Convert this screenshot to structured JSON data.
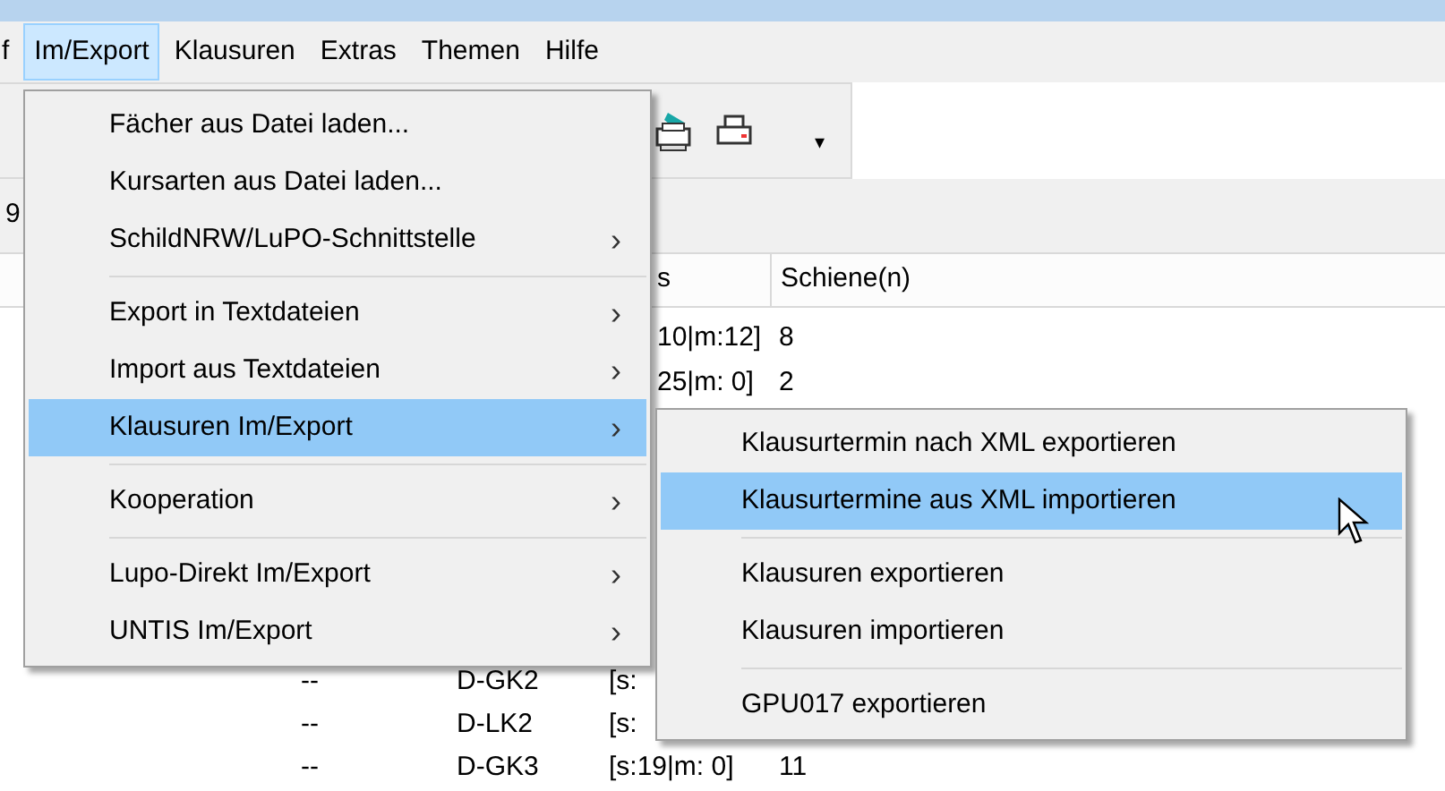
{
  "menu_bar": [
    {
      "label": "f",
      "selected": false
    },
    {
      "label": "Im/Export",
      "selected": true
    },
    {
      "label": "Klausuren",
      "selected": false
    },
    {
      "label": "Extras",
      "selected": false
    },
    {
      "label": "Themen",
      "selected": false
    },
    {
      "label": "Hilfe",
      "selected": false
    }
  ],
  "toolbar": {
    "dropdown_arrow": "▾"
  },
  "filter_bar": {
    "text": "9"
  },
  "table": {
    "columns": [
      {
        "label": "s"
      },
      {
        "label": "Schiene(n)"
      }
    ],
    "upper_rows": [
      {
        "column_3": "10|m:12]",
        "column_4": "8"
      },
      {
        "column_3": "25|m: 0]",
        "column_4": "2"
      }
    ],
    "lower_rows": [
      {
        "column_1": "--",
        "column_2": "D-GK2",
        "column_3": "[s:"
      },
      {
        "column_1": "--",
        "column_2": "D-LK2",
        "column_3": "[s:"
      },
      {
        "column_1": "--",
        "column_2": "D-GK3",
        "column_3": "[s:19|m: 0]",
        "column_4": "11"
      }
    ]
  },
  "menu": {
    "items": [
      {
        "kind": "item",
        "label": "Fächer aus Datei laden...",
        "has_submenu": false,
        "selected": false
      },
      {
        "kind": "item",
        "label": "Kursarten aus Datei laden...",
        "has_submenu": false,
        "selected": false
      },
      {
        "kind": "item",
        "label": "SchildNRW/LuPO-Schnittstelle",
        "has_submenu": true,
        "selected": false
      },
      {
        "kind": "separator"
      },
      {
        "kind": "item",
        "label": "Export in Textdateien",
        "has_submenu": true,
        "selected": false
      },
      {
        "kind": "item",
        "label": "Import aus Textdateien",
        "has_submenu": true,
        "selected": false
      },
      {
        "kind": "item",
        "label": "Klausuren Im/Export",
        "has_submenu": true,
        "selected": true
      },
      {
        "kind": "separator"
      },
      {
        "kind": "item",
        "label": "Kooperation",
        "has_submenu": true,
        "selected": false
      },
      {
        "kind": "separator"
      },
      {
        "kind": "item",
        "label": "Lupo-Direkt Im/Export",
        "has_submenu": true,
        "selected": false
      },
      {
        "kind": "item",
        "label": "UNTIS Im/Export",
        "has_submenu": true,
        "selected": false
      }
    ]
  },
  "submenu": {
    "items": [
      {
        "kind": "item",
        "label": "Klausurtermin nach XML exportieren",
        "has_submenu": false,
        "selected": false
      },
      {
        "kind": "item",
        "label": "Klausurtermine aus XML importieren",
        "has_submenu": false,
        "selected": true
      },
      {
        "kind": "separator"
      },
      {
        "kind": "item",
        "label": "Klausuren exportieren",
        "has_submenu": false,
        "selected": false
      },
      {
        "kind": "item",
        "label": "Klausuren importieren",
        "has_submenu": false,
        "selected": false
      },
      {
        "kind": "separator"
      },
      {
        "kind": "item",
        "label": "GPU017 exportieren",
        "has_submenu": false,
        "selected": false
      }
    ]
  },
  "submenu_arrow": "›"
}
